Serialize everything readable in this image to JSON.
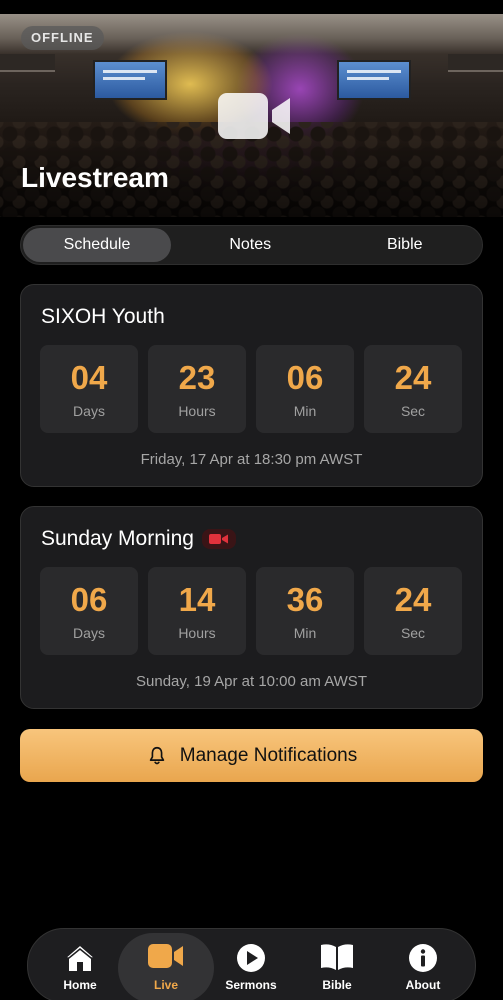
{
  "hero": {
    "status_badge": "OFFLINE",
    "title": "Livestream",
    "icon": "video-camera-icon"
  },
  "tabs": [
    {
      "label": "Schedule",
      "active": true
    },
    {
      "label": "Notes",
      "active": false
    },
    {
      "label": "Bible",
      "active": false
    }
  ],
  "events": [
    {
      "title": "SIXOH Youth",
      "live": false,
      "countdown": [
        {
          "value": "04",
          "unit": "Days"
        },
        {
          "value": "23",
          "unit": "Hours"
        },
        {
          "value": "06",
          "unit": "Min"
        },
        {
          "value": "24",
          "unit": "Sec"
        }
      ],
      "date": "Friday, 17 Apr at 18:30 pm AWST"
    },
    {
      "title": "Sunday Morning",
      "live": true,
      "live_icon": "video-camera-icon",
      "countdown": [
        {
          "value": "06",
          "unit": "Days"
        },
        {
          "value": "14",
          "unit": "Hours"
        },
        {
          "value": "36",
          "unit": "Min"
        },
        {
          "value": "24",
          "unit": "Sec"
        }
      ],
      "date": "Sunday, 19 Apr at 10:00 am AWST"
    }
  ],
  "notify_button": {
    "label": "Manage Notifications",
    "icon": "bell-icon"
  },
  "nav": [
    {
      "label": "Home",
      "icon": "home-icon",
      "active": false
    },
    {
      "label": "Live",
      "icon": "video-camera-icon",
      "active": true
    },
    {
      "label": "Sermons",
      "icon": "play-icon",
      "active": false
    },
    {
      "label": "Bible",
      "icon": "book-icon",
      "active": false
    },
    {
      "label": "About",
      "icon": "info-icon",
      "active": false
    }
  ],
  "colors": {
    "accent": "#f0a84a",
    "button": "#f3b865",
    "card": "#1c1c1e",
    "live_red": "#e0323c"
  }
}
